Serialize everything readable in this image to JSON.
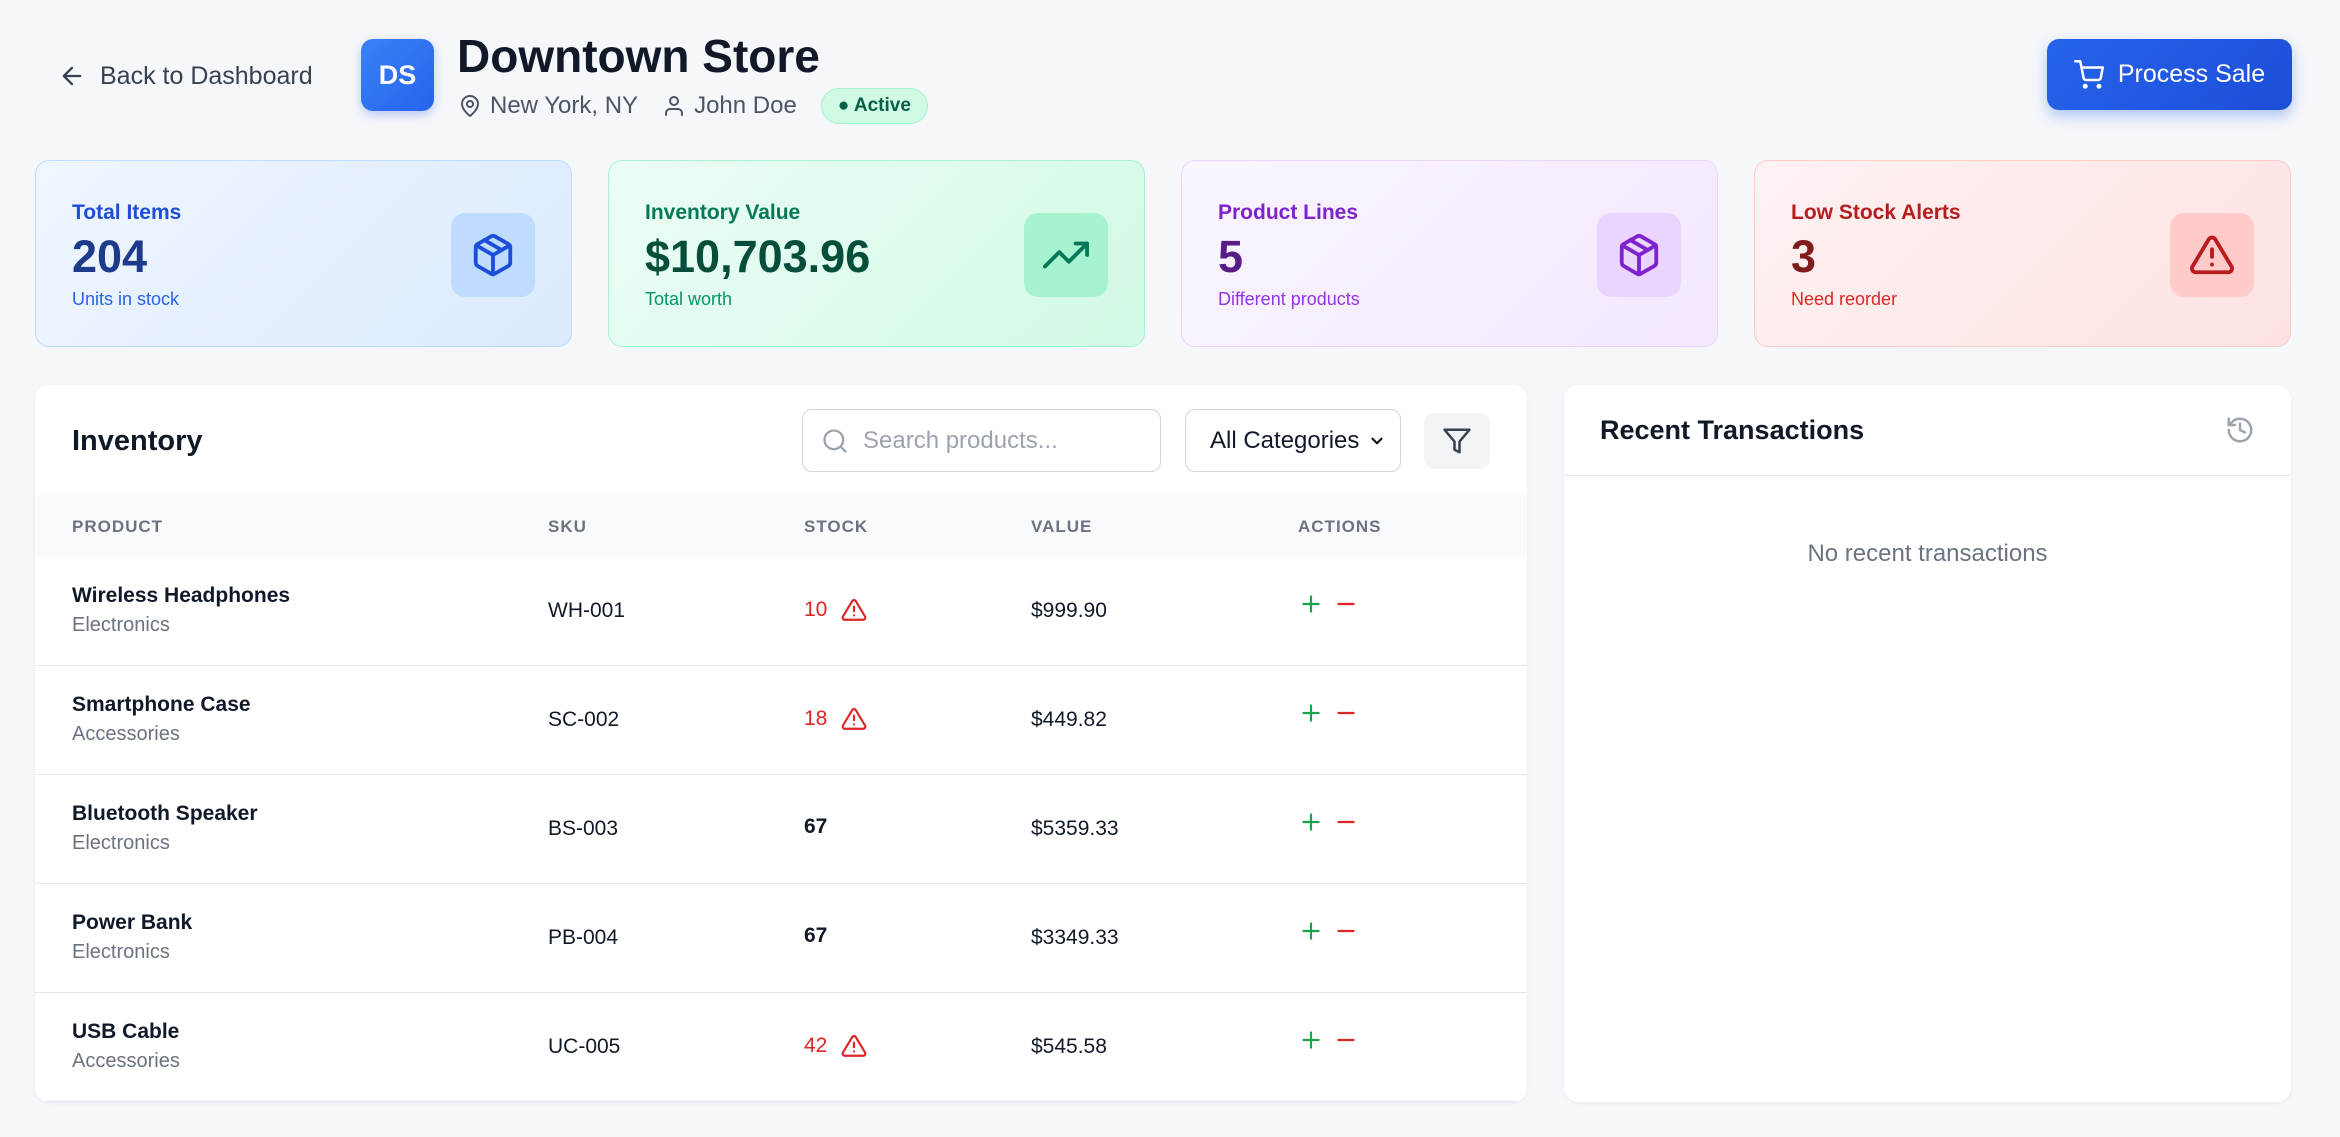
{
  "header": {
    "back_label": "Back to Dashboard",
    "store_initials": "DS",
    "store_name": "Downtown Store",
    "location": "New York, NY",
    "manager": "John Doe",
    "status": "● Active",
    "process_sale_label": "Process Sale"
  },
  "stats": [
    {
      "label": "Total Items",
      "value": "204",
      "sub": "Units in stock",
      "icon": "box-icon"
    },
    {
      "label": "Inventory Value",
      "value": "$10,703.96",
      "sub": "Total worth",
      "icon": "trending-up-icon"
    },
    {
      "label": "Product Lines",
      "value": "5",
      "sub": "Different products",
      "icon": "box-icon"
    },
    {
      "label": "Low Stock Alerts",
      "value": "3",
      "sub": "Need reorder",
      "icon": "alert-triangle-icon"
    }
  ],
  "inventory": {
    "title": "Inventory",
    "search_placeholder": "Search products...",
    "category_selected": "All Categories",
    "columns": [
      "PRODUCT",
      "SKU",
      "STOCK",
      "VALUE",
      "ACTIONS"
    ],
    "rows": [
      {
        "name": "Wireless Headphones",
        "category": "Electronics",
        "sku": "WH-001",
        "stock": "10",
        "low": true,
        "value": "$999.90"
      },
      {
        "name": "Smartphone Case",
        "category": "Accessories",
        "sku": "SC-002",
        "stock": "18",
        "low": true,
        "value": "$449.82"
      },
      {
        "name": "Bluetooth Speaker",
        "category": "Electronics",
        "sku": "BS-003",
        "stock": "67",
        "low": false,
        "value": "$5359.33"
      },
      {
        "name": "Power Bank",
        "category": "Electronics",
        "sku": "PB-004",
        "stock": "67",
        "low": false,
        "value": "$3349.33"
      },
      {
        "name": "USB Cable",
        "category": "Accessories",
        "sku": "UC-005",
        "stock": "42",
        "low": true,
        "value": "$545.58"
      }
    ]
  },
  "transactions": {
    "title": "Recent Transactions",
    "empty_text": "No recent transactions"
  },
  "colors": {
    "accent": "#2563eb",
    "stock_low": "#dc2626",
    "action_add": "#16a34a",
    "action_remove": "#dc2626"
  }
}
